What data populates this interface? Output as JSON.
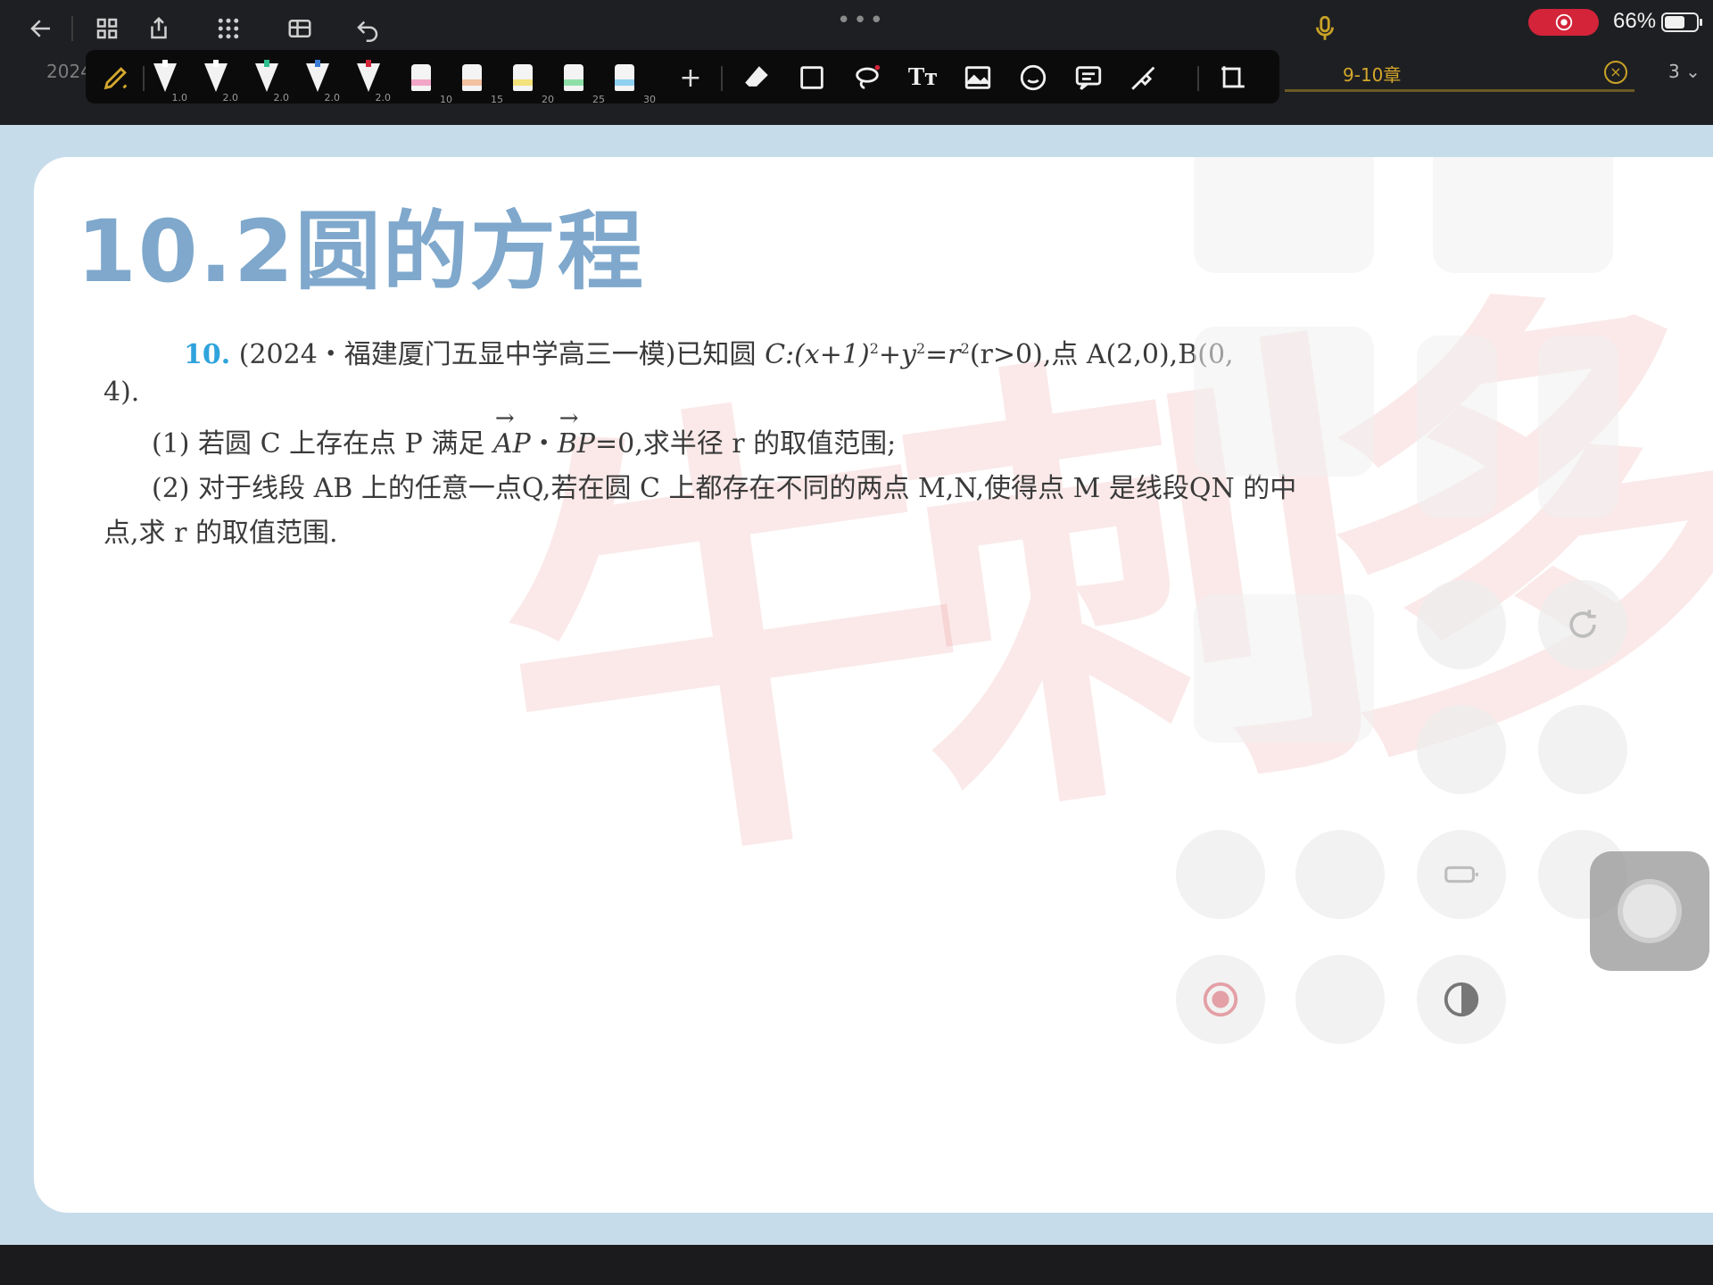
{
  "status_bar": {
    "battery_percent": "66%",
    "battery_level": 0.66,
    "more_dots": "•••"
  },
  "colors": {
    "accent_gold": "#d4a72c",
    "record_red": "#d3243a",
    "question_blue": "#2fa3dc",
    "title_blue": "#7fa8cc",
    "page_bg": "#c7dceb"
  },
  "top_icons": [
    "back-arrow-icon",
    "grid-icon",
    "share-icon",
    "apps-icon",
    "layout-icon",
    "undo-icon"
  ],
  "tabs": {
    "left_partial": "2024",
    "active": "9-10章",
    "page_count": "3"
  },
  "pen_toolbar": {
    "pens": [
      {
        "size": "1.0",
        "color": "#ffffff"
      },
      {
        "size": "2.0",
        "color": "#ffffff"
      },
      {
        "size": "2.0",
        "color": "#2fbf8f"
      },
      {
        "size": "2.0",
        "color": "#3a7bd5"
      },
      {
        "size": "2.0",
        "color": "#d3243a"
      }
    ],
    "highlighters": [
      {
        "size": "10",
        "color": "#f2a6c7"
      },
      {
        "size": "15",
        "color": "#f3c2a0"
      },
      {
        "size": "20",
        "color": "#f4e27a"
      },
      {
        "size": "25",
        "color": "#8fe0a8"
      },
      {
        "size": "30",
        "color": "#8fd0f0"
      }
    ],
    "add_label": "+",
    "text_tool_label": "Tт"
  },
  "document": {
    "section_title": "10.2圆的方程",
    "watermark": "牛刺多",
    "question_number": "10.",
    "question_source": "(2024・福建厦门五显中学高三一模)已知圆",
    "circle_name": "C",
    "circle_eq": ":(x+1)",
    "exp2": "2",
    "plus_y": "+y",
    "eq_r": "=r",
    "r_cond": "(r>0),点 A(2,0),B(0,",
    "line2": "4).",
    "part1_a": "(1) 若圆 C 上存在点 P 满足",
    "vec_ap": "AP",
    "dot": "・",
    "vec_bp": "BP",
    "part1_b": "=0,求半径 r 的取值范围;",
    "part2_a": "(2) 对于线段 AB 上的任意一点Q,若在圆 C 上都存在不同的两点 M,N,使得点 M 是线段QN 的中",
    "part2_b": "点,求 r 的取值范围."
  }
}
